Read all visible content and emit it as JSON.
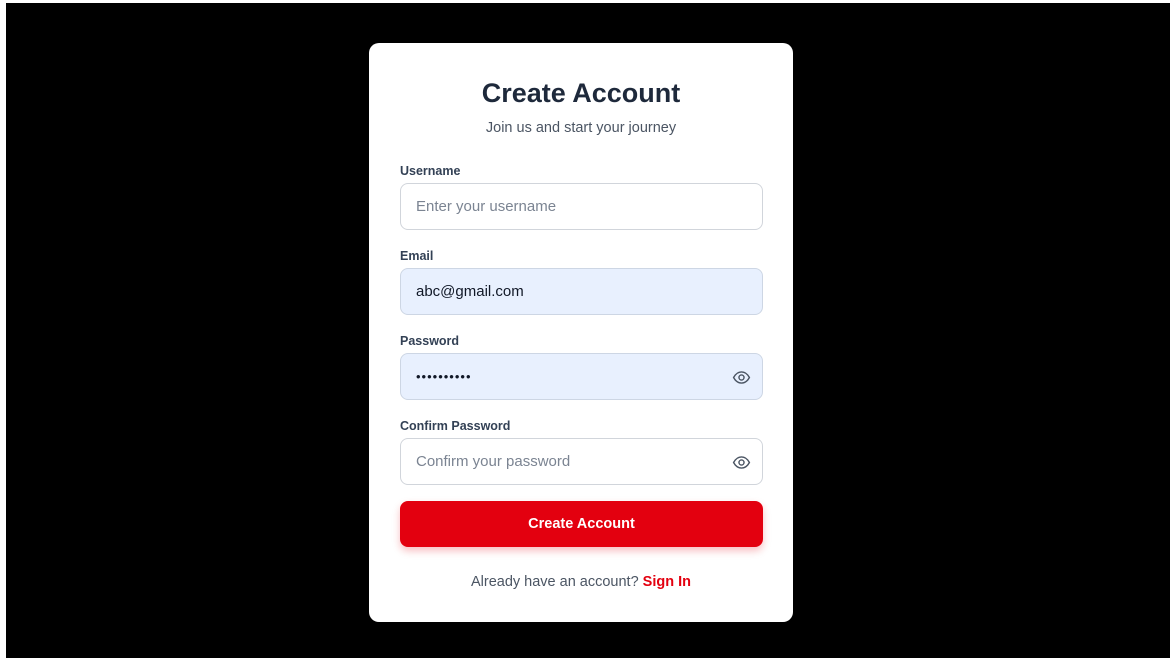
{
  "form": {
    "title": "Create Account",
    "subtitle": "Join us and start your journey",
    "username": {
      "label": "Username",
      "placeholder": "Enter your username",
      "value": ""
    },
    "email": {
      "label": "Email",
      "placeholder": "",
      "value": "abc@gmail.com"
    },
    "password": {
      "label": "Password",
      "value": "••••••••••",
      "icon": "eye-icon"
    },
    "confirm_password": {
      "label": "Confirm Password",
      "placeholder": "Confirm your password",
      "value": "",
      "icon": "eye-icon"
    },
    "submit_label": "Create Account",
    "footer_text": "Already have an account?",
    "footer_link": "Sign In"
  },
  "colors": {
    "accent": "#e3000f",
    "autofill_bg": "#e8f0fe",
    "page_bg": "#000000",
    "card_bg": "#ffffff"
  }
}
